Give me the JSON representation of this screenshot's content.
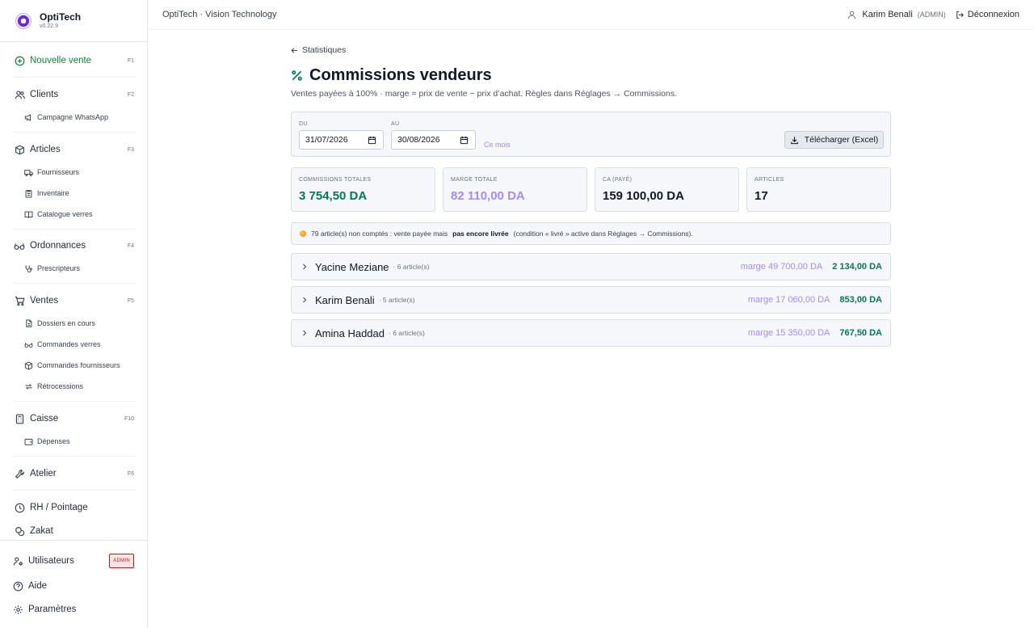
{
  "brand": {
    "name": "OptiTech",
    "version": "v0.22.9"
  },
  "sidebar": {
    "new_sale": {
      "label": "Nouvelle vente",
      "key": "F1"
    },
    "clients": {
      "label": "Clients",
      "key": "F2"
    },
    "whatsapp": {
      "label": "Campagne WhatsApp"
    },
    "articles": {
      "label": "Articles",
      "key": "F3"
    },
    "suppliers": {
      "label": "Fournisseurs"
    },
    "inventory": {
      "label": "Inventaire"
    },
    "catalog": {
      "label": "Catalogue verres"
    },
    "prescriptions": {
      "label": "Ordonnances",
      "key": "F4"
    },
    "prescribers": {
      "label": "Prescripteurs"
    },
    "sales": {
      "label": "Ventes",
      "key": "F5"
    },
    "files": {
      "label": "Dossiers en cours"
    },
    "lens_orders": {
      "label": "Commandes verres"
    },
    "supplier_orders": {
      "label": "Commandes fournisseurs"
    },
    "retro": {
      "label": "Rétrocessions"
    },
    "cash": {
      "label": "Caisse",
      "key": "F10"
    },
    "expenses": {
      "label": "Dépenses"
    },
    "workshop": {
      "label": "Atelier",
      "key": "F6"
    },
    "hr": {
      "label": "RH / Pointage"
    },
    "zakat": {
      "label": "Zakat"
    },
    "users": {
      "label": "Utilisateurs",
      "badge": "ADMIN"
    },
    "help": {
      "label": "Aide"
    },
    "settings": {
      "label": "Paramètres"
    }
  },
  "topbar": {
    "title": "OptiTech · Vision Technology",
    "user_name": "Karim Benali",
    "user_role": "(ADMIN)",
    "logout": "Déconnexion"
  },
  "page": {
    "back_label": "Statistiques",
    "title": "Commissions vendeurs",
    "subtitle": "Ventes payées à 100% · marge = prix de vente − prix d’achat. Règles dans Réglages → Commissions."
  },
  "filters": {
    "from_label": "DU",
    "from_value": "31/07/2026",
    "to_label": "AU",
    "to_value": "30/08/2026",
    "this_month": "Ce mois",
    "download": "Télécharger (Excel)"
  },
  "stats": {
    "commissions": {
      "label": "COMMISSIONS TOTALES",
      "value": "3 754,50 DA"
    },
    "margin": {
      "label": "MARGE TOTALE",
      "value": "82 110,00 DA"
    },
    "revenue": {
      "label": "CA (PAYÉ)",
      "value": "159 100,00 DA"
    },
    "articles": {
      "label": "ARTICLES",
      "value": "17"
    }
  },
  "notice": {
    "part1": "79 article(s) non comptés : vente payée mais",
    "bold": "pas encore livrée",
    "part2": "(condition « livré » active dans Réglages → Commissions)."
  },
  "sellers": [
    {
      "name": "Yacine Meziane",
      "count": "· 6 article(s)",
      "marge": "marge 49 700,00 DA",
      "commission": "2 134,00 DA"
    },
    {
      "name": "Karim Benali",
      "count": "· 5 article(s)",
      "marge": "marge 17 060,00 DA",
      "commission": "853,00 DA"
    },
    {
      "name": "Amina Haddad",
      "count": "· 6 article(s)",
      "marge": "marge 15 350,00 DA",
      "commission": "767,50 DA"
    }
  ],
  "colors": {
    "accent_green": "#047857",
    "accent_purple": "#a78bfa",
    "admin_red": "#b91c1c"
  }
}
